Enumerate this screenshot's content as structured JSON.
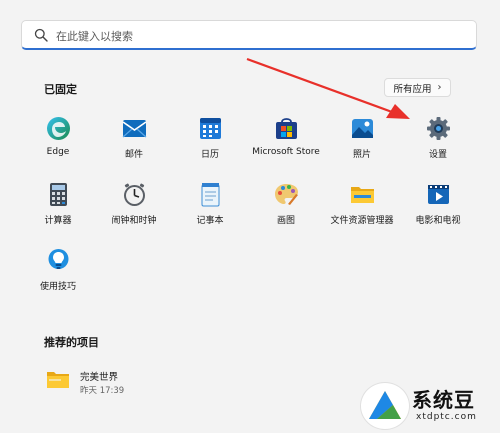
{
  "search": {
    "placeholder": "在此键入以搜索"
  },
  "pinned": {
    "title": "已固定",
    "all_apps_label": "所有应用",
    "apps": [
      {
        "label": "Edge",
        "icon": "edge-icon"
      },
      {
        "label": "邮件",
        "icon": "mail-icon"
      },
      {
        "label": "日历",
        "icon": "calendar-icon"
      },
      {
        "label": "Microsoft Store",
        "icon": "store-icon"
      },
      {
        "label": "照片",
        "icon": "photos-icon"
      },
      {
        "label": "设置",
        "icon": "gear-icon"
      },
      {
        "label": "计算器",
        "icon": "calculator-icon"
      },
      {
        "label": "闹钟和时钟",
        "icon": "clock-icon"
      },
      {
        "label": "记事本",
        "icon": "notepad-icon"
      },
      {
        "label": "画图",
        "icon": "paint-icon"
      },
      {
        "label": "文件资源管理器",
        "icon": "folder-icon"
      },
      {
        "label": "电影和电视",
        "icon": "movies-icon"
      },
      {
        "label": "使用技巧",
        "icon": "tips-icon"
      }
    ]
  },
  "recommended": {
    "title": "推荐的项目",
    "items": [
      {
        "name": "完美世界",
        "time": "昨天 17:39",
        "icon": "folder-icon"
      }
    ]
  },
  "watermark": {
    "title": "系统豆",
    "url": "xtdptc.com"
  },
  "colors": {
    "accent": "#2f6fd0",
    "annotation_arrow": "#e8302a"
  }
}
